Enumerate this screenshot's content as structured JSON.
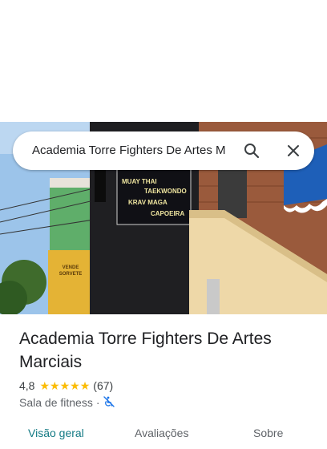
{
  "search": {
    "query": "Academia Torre Fighters De Artes M"
  },
  "photo": {
    "sign_lines": [
      "MUAY THAI",
      "TAEKWONDO",
      "KRAV MAGA",
      "CAPOEIRA"
    ],
    "poster_lines": [
      "VENDE",
      "SORVETE"
    ]
  },
  "place": {
    "name": "Academia Torre Fighters De Artes Marciais",
    "rating": "4,8",
    "stars": 4.8,
    "reviews": "(67)",
    "category": "Sala de fitness",
    "separator": "·"
  },
  "tabs": [
    {
      "label": "Visão geral",
      "active": true
    },
    {
      "label": "Avaliações",
      "active": false
    },
    {
      "label": "Sobre",
      "active": false
    }
  ],
  "colors": {
    "accent": "#137a84",
    "star": "#fbbc04"
  },
  "icons": {
    "search": "magnifier-icon",
    "close": "close-icon",
    "accessibility": "wheelchair-off-icon"
  }
}
